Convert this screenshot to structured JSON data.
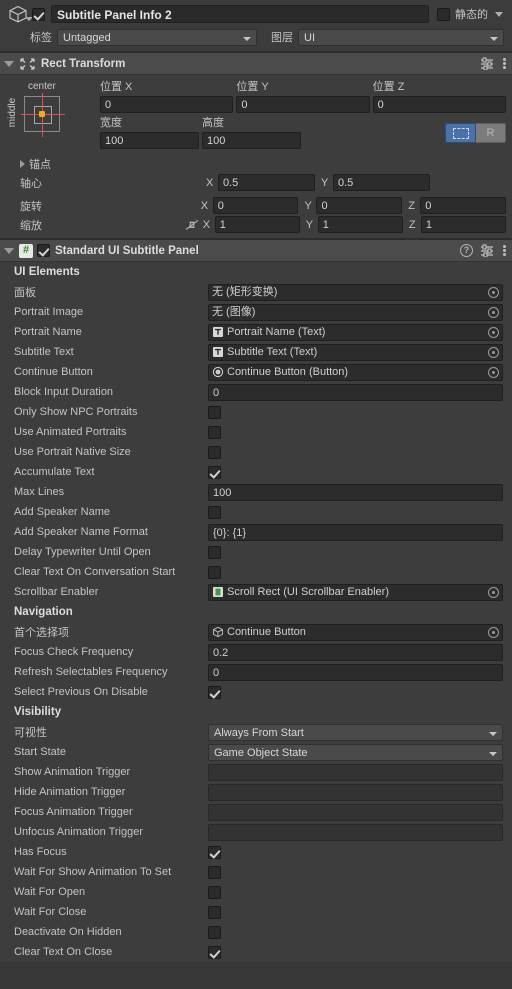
{
  "gameobject": {
    "icon": "cube-icon",
    "enabled": true,
    "name": "Subtitle Panel Info 2",
    "static_label": "静态的",
    "static_checked": false,
    "tag_label": "标签",
    "tag_value": "Untagged",
    "layer_label": "图层",
    "layer_value": "UI"
  },
  "rect_transform": {
    "title": "Rect Transform",
    "anchor_preset": {
      "horizontal": "center",
      "vertical": "middle"
    },
    "pos_labels": [
      "位置 X",
      "位置 Y",
      "位置 Z"
    ],
    "pos_values": [
      "0",
      "0",
      "0"
    ],
    "size_labels": [
      "宽度",
      "高度"
    ],
    "size_values": [
      "100",
      "100"
    ],
    "blockbtn_label": "R",
    "anchors_label": "锚点",
    "pivot_label": "轴心",
    "pivot_x": "0.5",
    "pivot_y": "0.5",
    "rotation_label": "旋转",
    "rotation": [
      "0",
      "0",
      "0"
    ],
    "scale_label": "缩放",
    "scale": [
      "1",
      "1",
      "1"
    ],
    "axis_labels": [
      "X",
      "Y",
      "Z"
    ]
  },
  "component": {
    "title": "Standard UI Subtitle Panel",
    "enabled": true,
    "script_icon_char": "#"
  },
  "sections": [
    {
      "header": "UI Elements",
      "rows": [
        {
          "label": "面板",
          "type": "object",
          "value": "无 (矩形变换)",
          "icon": "none"
        },
        {
          "label": "Portrait Image",
          "type": "object",
          "value": "无 (图像)",
          "icon": "none"
        },
        {
          "label": "Portrait Name",
          "type": "object",
          "value": "Portrait Name (Text)",
          "icon": "text-icon"
        },
        {
          "label": "Subtitle Text",
          "type": "object",
          "value": "Subtitle Text (Text)",
          "icon": "text-icon"
        },
        {
          "label": "Continue Button",
          "type": "object",
          "value": "Continue Button (Button)",
          "icon": "button-icon"
        },
        {
          "label": "Block Input Duration",
          "type": "number",
          "value": "0"
        },
        {
          "label": "Only Show NPC Portraits",
          "type": "checkbox",
          "checked": false
        },
        {
          "label": "Use Animated Portraits",
          "type": "checkbox",
          "checked": false
        },
        {
          "label": "Use Portrait Native Size",
          "type": "checkbox",
          "checked": false
        },
        {
          "label": "Accumulate Text",
          "type": "checkbox",
          "checked": true
        },
        {
          "label": "Max Lines",
          "type": "number",
          "value": "100"
        },
        {
          "label": "Add Speaker Name",
          "type": "checkbox",
          "checked": false
        },
        {
          "label": "Add Speaker Name Format",
          "type": "text",
          "value": "{0}: {1}"
        },
        {
          "label": "Delay Typewriter Until Open",
          "type": "checkbox",
          "checked": false
        },
        {
          "label": "Clear Text On Conversation Start",
          "type": "checkbox",
          "checked": false
        },
        {
          "label": "Scrollbar Enabler",
          "type": "object",
          "value": "Scroll Rect (UI Scrollbar Enabler)",
          "icon": "script-icon"
        }
      ]
    },
    {
      "header": "Navigation",
      "rows": [
        {
          "label": "首个选择项",
          "type": "object",
          "value": "Continue Button",
          "icon": "gameobject-icon"
        },
        {
          "label": "Focus Check Frequency",
          "type": "number",
          "value": "0.2"
        },
        {
          "label": "Refresh Selectables Frequency",
          "type": "number",
          "value": "0"
        },
        {
          "label": "Select Previous On Disable",
          "type": "checkbox",
          "checked": true
        }
      ]
    },
    {
      "header": "Visibility",
      "rows": [
        {
          "label": "可视性",
          "type": "dropdown",
          "value": "Always From Start"
        },
        {
          "label": "Start State",
          "type": "dropdown",
          "value": "Game Object State"
        },
        {
          "label": "Show Animation Trigger",
          "type": "text",
          "value": ""
        },
        {
          "label": "Hide Animation Trigger",
          "type": "text",
          "value": ""
        },
        {
          "label": "Focus Animation Trigger",
          "type": "text",
          "value": ""
        },
        {
          "label": "Unfocus Animation Trigger",
          "type": "text",
          "value": ""
        },
        {
          "label": "Has Focus",
          "type": "checkbox",
          "checked": true
        },
        {
          "label": "Wait For Show Animation To Set",
          "type": "checkbox",
          "checked": false
        },
        {
          "label": "Wait For Open",
          "type": "checkbox",
          "checked": false
        },
        {
          "label": "Wait For Close",
          "type": "checkbox",
          "checked": false
        },
        {
          "label": "Deactivate On Hidden",
          "type": "checkbox",
          "checked": false
        },
        {
          "label": "Clear Text On Close",
          "type": "checkbox",
          "checked": true
        }
      ]
    }
  ],
  "colors": {
    "background": "#383838",
    "header_bar": "#3c3c3c",
    "component_header": "#4b4b4b",
    "field_bg": "#2c2c2c",
    "accent_blue": "#4a72a8",
    "anchor_red": "#e05050",
    "anchor_pivot": "#f0a818",
    "script_green": "#2a8f2a"
  }
}
